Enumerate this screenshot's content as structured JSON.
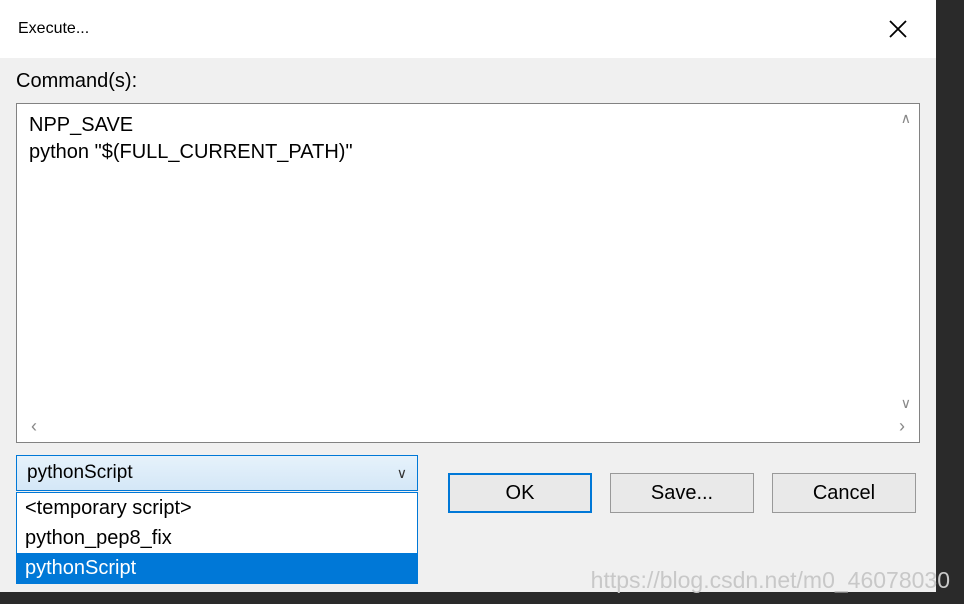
{
  "dialog": {
    "title": "Execute...",
    "commands_label": "Command(s):",
    "commands_text": "NPP_SAVE\npython \"$(FULL_CURRENT_PATH)\""
  },
  "dropdown": {
    "selected": "pythonScript",
    "options": [
      "<temporary script>",
      "python_pep8_fix",
      "pythonScript"
    ]
  },
  "buttons": {
    "ok": "OK",
    "save": "Save...",
    "cancel": "Cancel"
  },
  "watermark": "https://blog.csdn.net/m0_46078030"
}
